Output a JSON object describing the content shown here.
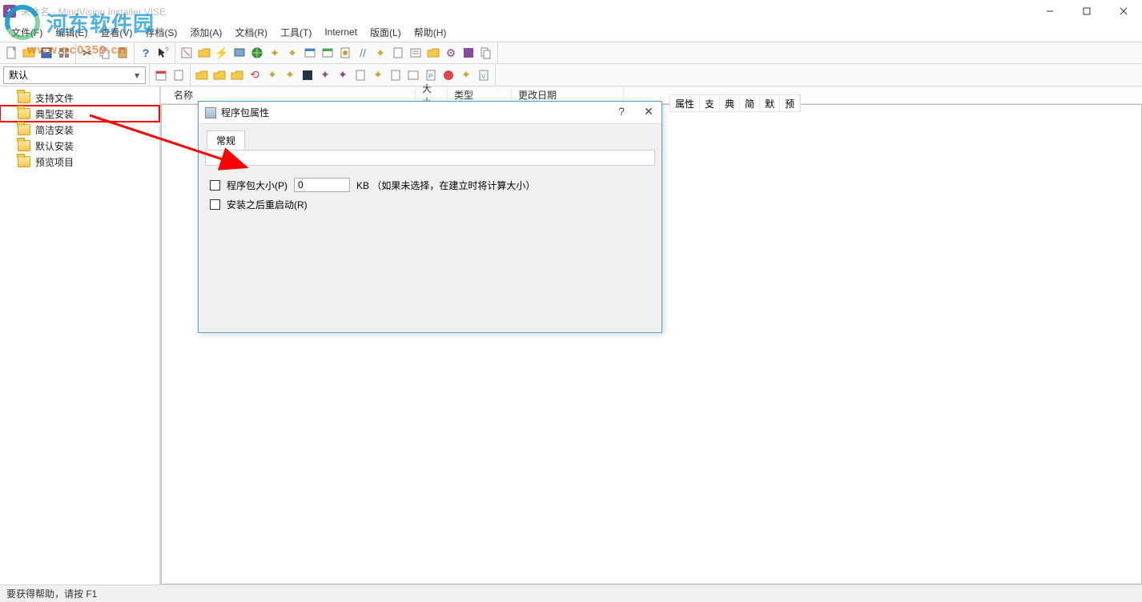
{
  "window": {
    "title": "未命名 - MindVision Installer VISE",
    "watermark_text": "河东软件园",
    "watermark_url": "www.pc0359.cn"
  },
  "menu": {
    "file": "文件(F)",
    "edit": "编辑(E)",
    "view": "查看(V)",
    "archive": "存档(S)",
    "add": "添加(A)",
    "document": "文档(R)",
    "tools": "工具(T)",
    "internet": "Internet",
    "layout": "版面(L)",
    "help": "帮助(H)"
  },
  "combo": {
    "value": "默认"
  },
  "tree": {
    "items": [
      {
        "label": "支持文件"
      },
      {
        "label": "典型安装",
        "selected": true
      },
      {
        "label": "简洁安装"
      },
      {
        "label": "默认安装"
      },
      {
        "label": "预览项目"
      }
    ]
  },
  "list": {
    "columns": {
      "name": "名称",
      "size": "大小",
      "type": "类型",
      "date": "更改日期"
    }
  },
  "right_tabs": [
    "属性",
    "支",
    "典",
    "简",
    "默",
    "预"
  ],
  "dialog": {
    "title": "程序包属性",
    "tab_general": "常规",
    "field_size_label": "程序包大小(P)",
    "field_size_value": "0",
    "field_size_suffix": "KB （如果未选择，在建立时将计算大小）",
    "field_reboot_label": "安装之后重启动(R)"
  },
  "status": {
    "help": "要获得帮助，请按 F1"
  }
}
